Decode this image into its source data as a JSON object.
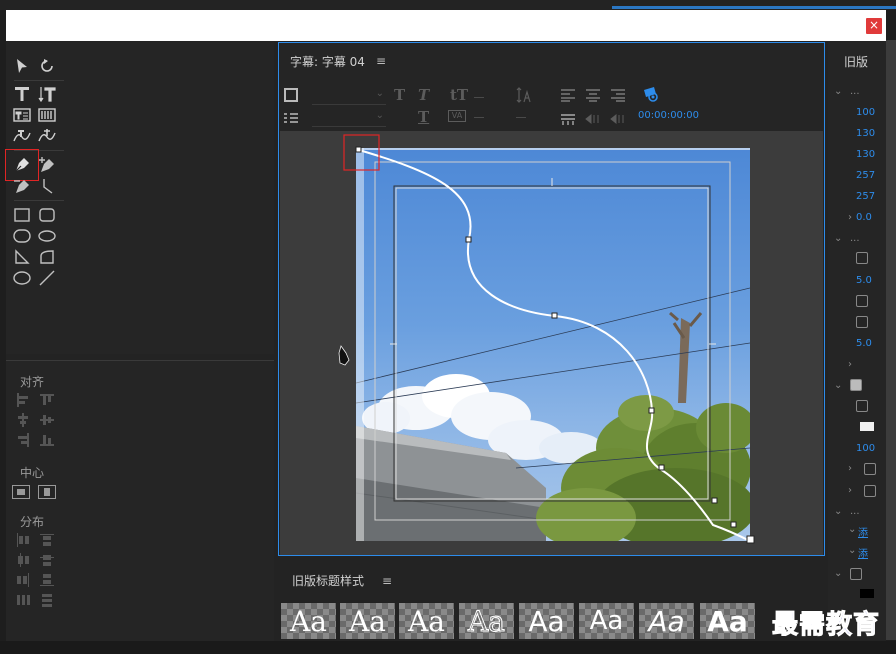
{
  "title_panel": {
    "header": "字幕: 字幕 04",
    "menu_icon": "≡",
    "timecode": "00:00:00:00"
  },
  "window": {
    "close_label": "×"
  },
  "align_panel": {
    "align_label": "对齐",
    "center_label": "中心",
    "distribute_label": "分布"
  },
  "styles_panel": {
    "header": "旧版标题样式",
    "menu_icon": "≡",
    "swatches": [
      "Aa",
      "Aa",
      "Aa",
      "Aa",
      "Aa",
      "Aa",
      "Aa",
      "Aa"
    ]
  },
  "props_panel": {
    "header": "旧版",
    "values": [
      "100",
      "130",
      "130",
      "257",
      "257",
      "0.0",
      "5.0",
      "5.0",
      "100"
    ],
    "links": [
      "添",
      "添"
    ]
  },
  "watermark": "最需教育",
  "colors": {
    "accent": "#2d8ceb",
    "selection": "#e02525",
    "sky": "#5b93d9"
  }
}
